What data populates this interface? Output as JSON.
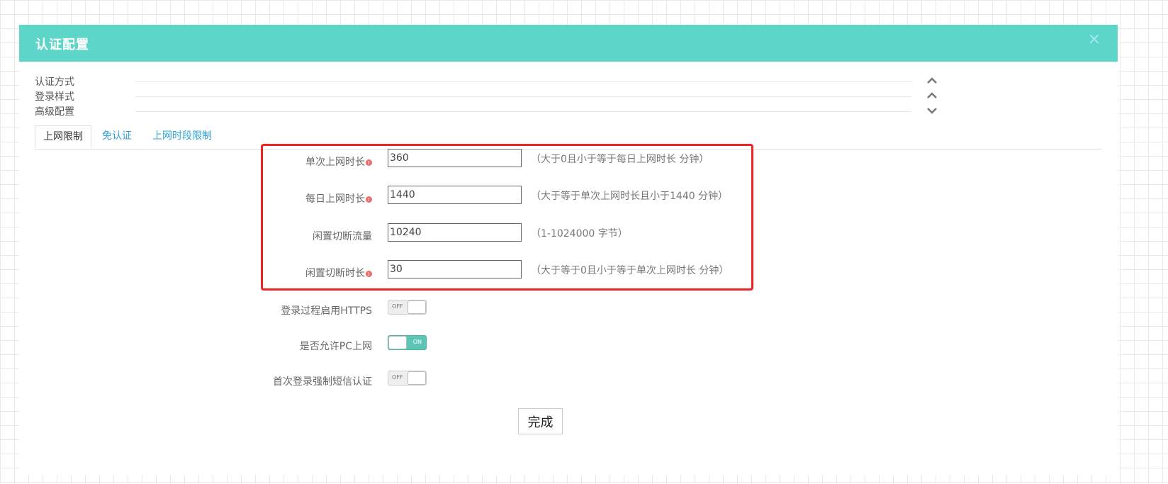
{
  "dialog": {
    "title": "认证配置",
    "close_icon": "×"
  },
  "sections": [
    {
      "label": "认证方式",
      "icon": "chevron-up-icon"
    },
    {
      "label": "登录样式",
      "icon": "chevron-up-icon"
    },
    {
      "label": "高级配置",
      "icon": "chevron-down-icon"
    }
  ],
  "tabs": [
    {
      "label": "上网限制",
      "active": true
    },
    {
      "label": "免认证",
      "active": false
    },
    {
      "label": "上网时段限制",
      "active": false
    }
  ],
  "fields": [
    {
      "label": "单次上网时长",
      "value": "360",
      "hint": "（大于0且小于等于每日上网时长 分钟）",
      "required": true
    },
    {
      "label": "每日上网时长",
      "value": "1440",
      "hint": "（大于等于单次上网时长且小于1440 分钟）",
      "required": true
    },
    {
      "label": "闲置切断流量",
      "value": "10240",
      "hint": "（1-1024000 字节）",
      "required": false
    },
    {
      "label": "闲置切断时长",
      "value": "30",
      "hint": "（大于等于0且小于等于单次上网时长 分钟）",
      "required": true
    }
  ],
  "toggles": [
    {
      "label": "登录过程启用HTTPS",
      "state": "off",
      "text": "OFF"
    },
    {
      "label": "是否允许PC上网",
      "state": "on",
      "text": "ON"
    },
    {
      "label": "首次登录强制短信认证",
      "state": "off",
      "text": "OFF"
    }
  ],
  "colors": {
    "header": "#5dd5c8",
    "tab_link": "#2fa2d7",
    "required": "#f16a6a",
    "toggle_on": "#5dc5b6",
    "highlight": "#ee2222"
  },
  "submit_label": "完成"
}
